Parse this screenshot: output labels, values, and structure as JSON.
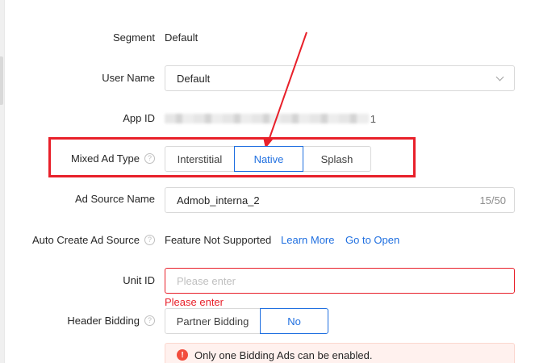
{
  "form": {
    "segment": {
      "label": "Segment",
      "value": "Default"
    },
    "user_name": {
      "label": "User Name",
      "value": "Default"
    },
    "app_id": {
      "label": "App ID",
      "masked_tail": "1"
    },
    "mixed_ad_type": {
      "label": "Mixed Ad Type",
      "options": [
        "Interstitial",
        "Native",
        "Splash"
      ],
      "selected": "Native"
    },
    "ad_source_name": {
      "label": "Ad Source Name",
      "value": "Admob_interna_2",
      "counter": "15/50"
    },
    "auto_create": {
      "label": "Auto Create Ad Source",
      "status": "Feature Not Supported",
      "learn_more": "Learn More",
      "go_open": "Go to Open"
    },
    "unit_id": {
      "label": "Unit ID",
      "placeholder": "Please enter",
      "error": "Please enter"
    },
    "header_bidding": {
      "label": "Header Bidding",
      "options": [
        "Partner Bidding",
        "No"
      ],
      "selected": "No"
    },
    "alert": {
      "message": "Only one Bidding Ads can be enabled."
    }
  },
  "colors": {
    "accent": "#1f6fe0",
    "error": "#e8202a",
    "annotation": "#e8202a"
  },
  "icons": {
    "help": "question-circle-icon",
    "dropdown": "chevron-down-icon",
    "alert": "exclamation-circle-icon"
  }
}
